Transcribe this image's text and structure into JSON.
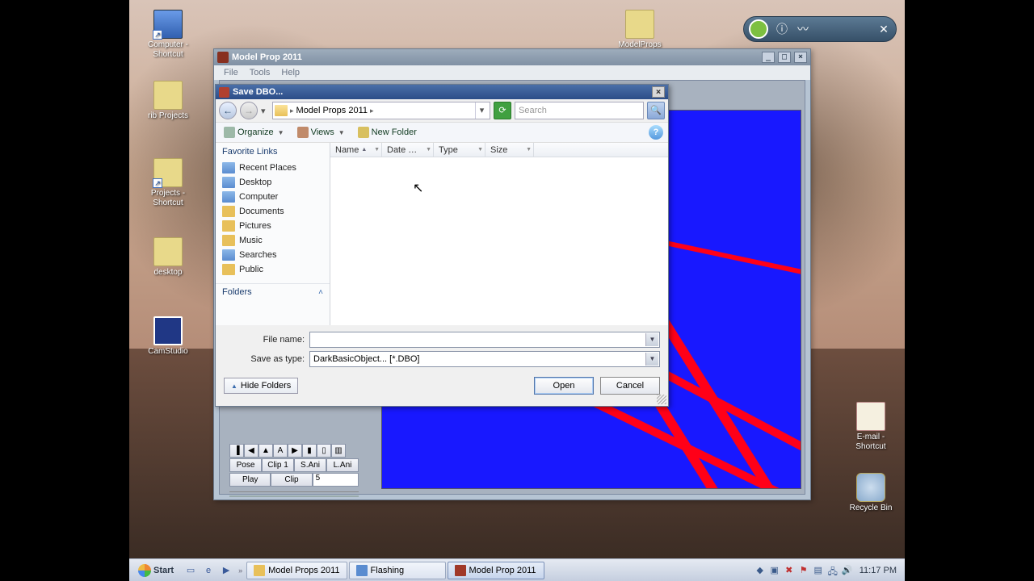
{
  "desktop_icons": {
    "computer": "Computer - Shortcut",
    "rib_projects": "rib Projects",
    "projects": "Projects - Shortcut",
    "desktop_folder": "desktop",
    "camstudio": "CamStudio",
    "modelprops_folder": "ModelProps",
    "email": "E-mail - Shortcut",
    "recycle": "Recycle Bin"
  },
  "app": {
    "title": "Model Prop 2011",
    "menu": {
      "file": "File",
      "tools": "Tools",
      "help": "Help"
    },
    "anim": {
      "pose": "Pose",
      "clip1": "Clip 1",
      "sani": "S.Ani",
      "lani": "L.Ani",
      "play": "Play",
      "clip": "Clip",
      "clip_val": "5"
    }
  },
  "dialog": {
    "title": "Save DBO...",
    "breadcrumb": "Model Props 2011",
    "search_placeholder": "Search",
    "toolbar": {
      "organize": "Organize",
      "views": "Views",
      "newfolder": "New Folder"
    },
    "places_header": "Favorite Links",
    "places": {
      "recent": "Recent Places",
      "desktop": "Desktop",
      "computer": "Computer",
      "documents": "Documents",
      "pictures": "Pictures",
      "music": "Music",
      "searches": "Searches",
      "public": "Public"
    },
    "folders_header": "Folders",
    "columns": {
      "name": "Name",
      "date": "Date …",
      "type": "Type",
      "size": "Size"
    },
    "filename_label": "File name:",
    "filename_value": "",
    "saveas_label": "Save as type:",
    "saveas_value": "DarkBasicObject... [*.DBO]",
    "hide_folders": "Hide Folders",
    "open": "Open",
    "cancel": "Cancel"
  },
  "taskbar": {
    "start": "Start",
    "tasks": {
      "a": "Model Props 2011",
      "b": "Flashing",
      "c": "Model Prop 2011"
    },
    "clock": "11:17 PM"
  }
}
